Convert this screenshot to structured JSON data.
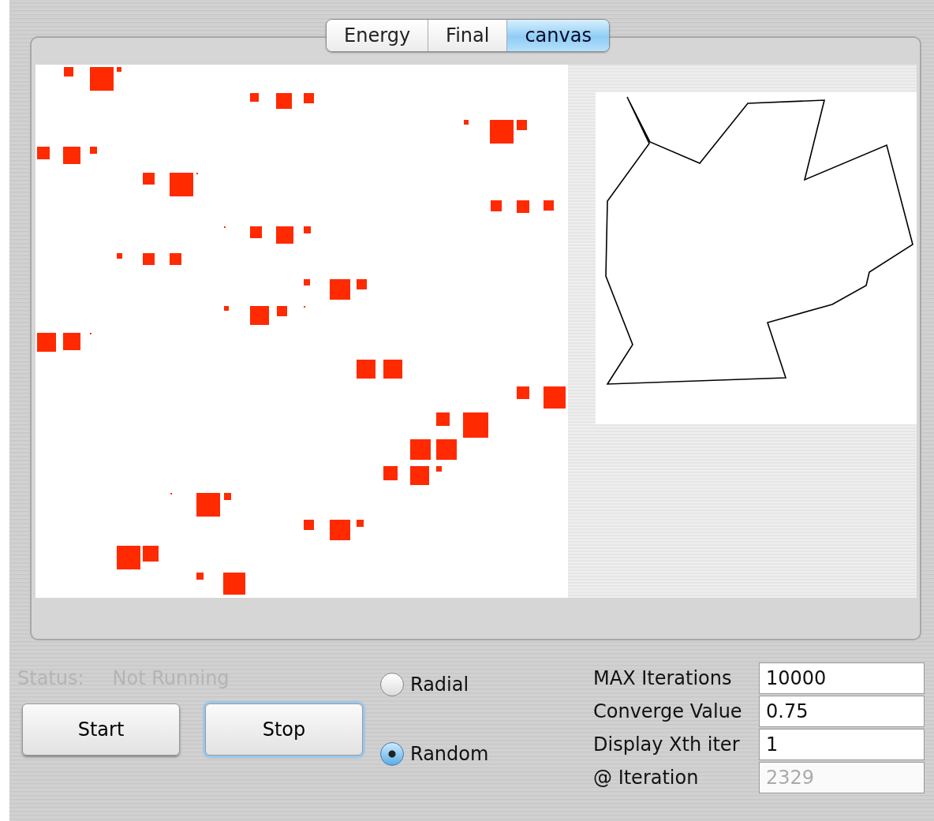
{
  "tabs": [
    {
      "label": "Energy",
      "selected": false
    },
    {
      "label": "Final",
      "selected": false
    },
    {
      "label": "canvas",
      "selected": true
    }
  ],
  "status": {
    "label": "Status:",
    "value": "Not Running",
    "disabled": true
  },
  "buttons": [
    {
      "label": "Start",
      "focused": false
    },
    {
      "label": "Stop",
      "focused": true
    }
  ],
  "mode_options": [
    {
      "label": "Radial",
      "selected": false
    },
    {
      "label": "Random",
      "selected": true
    }
  ],
  "fields": [
    {
      "label": "MAX Iterations",
      "value": "10000",
      "disabled": false
    },
    {
      "label": "Converge Value",
      "value": "0.75",
      "disabled": false
    },
    {
      "label": "Display Xth iter",
      "value": "1",
      "disabled": false
    },
    {
      "label": "@ Iteration",
      "value": "2329",
      "disabled": true
    }
  ]
}
